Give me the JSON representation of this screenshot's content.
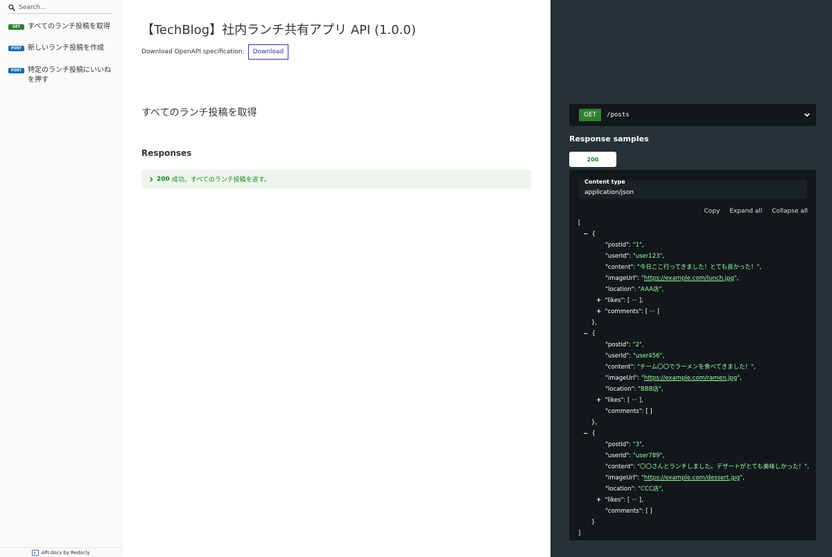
{
  "sidebar": {
    "search_placeholder": "Search...",
    "items": [
      {
        "method": "GET",
        "label": "すべてのランチ投稿を取得"
      },
      {
        "method": "POST",
        "label": "新しいランチ投稿を作成"
      },
      {
        "method": "POST",
        "label": "特定のランチ投稿にいいね\nを押す"
      }
    ],
    "footer": "API docs by Redocly"
  },
  "header": {
    "title": "【TechBlog】社内ランチ共有アプリ API (1.0.0)",
    "download_text": "Download OpenAPI specification:",
    "download_label": "Download"
  },
  "operation": {
    "title": "すべてのランチ投稿を取得",
    "responses_label": "Responses",
    "response": {
      "code": "200",
      "description": "成功。すべてのランチ投稿を返す。"
    }
  },
  "panel": {
    "method": "GET",
    "path": "/posts",
    "samples_title": "Response samples",
    "tab": "200",
    "content_type_label": "Content type",
    "content_type": "application/json",
    "actions": {
      "copy": "Copy",
      "expand": "Expand all",
      "collapse": "Collapse all"
    },
    "posts": [
      {
        "postId": "\"1\"",
        "userId": "\"user123\"",
        "content": "\"今日ここ行ってきました！とても良かった！\"",
        "imageUrl": "https://example.com/lunch.jpg",
        "location": "\"AAA店\"",
        "likes": "[ ··· ]",
        "comments": "[ ··· ]"
      },
      {
        "postId": "\"2\"",
        "userId": "\"user456\"",
        "content": "\"チーム〇〇でラーメンを食べてきました！\"",
        "imageUrl": "https://example.com/ramen.jpg",
        "location": "\"BBB店\"",
        "likes": "[ ··· ]",
        "comments": "[ ]"
      },
      {
        "postId": "\"3\"",
        "userId": "\"user789\"",
        "content": "\"〇〇さんとランチしました。デザートがとても美味しかった！\"",
        "imageUrl": "https://example.com/dessert.jpg",
        "location": "\"CCC店\"",
        "likes": "[ ··· ]",
        "comments": "[ ]"
      }
    ]
  },
  "colors": {
    "get": "#2f8132",
    "post": "#186fad",
    "panel_bg": "#263238",
    "code_bg": "#11171a",
    "string": "#a0fbaa"
  }
}
